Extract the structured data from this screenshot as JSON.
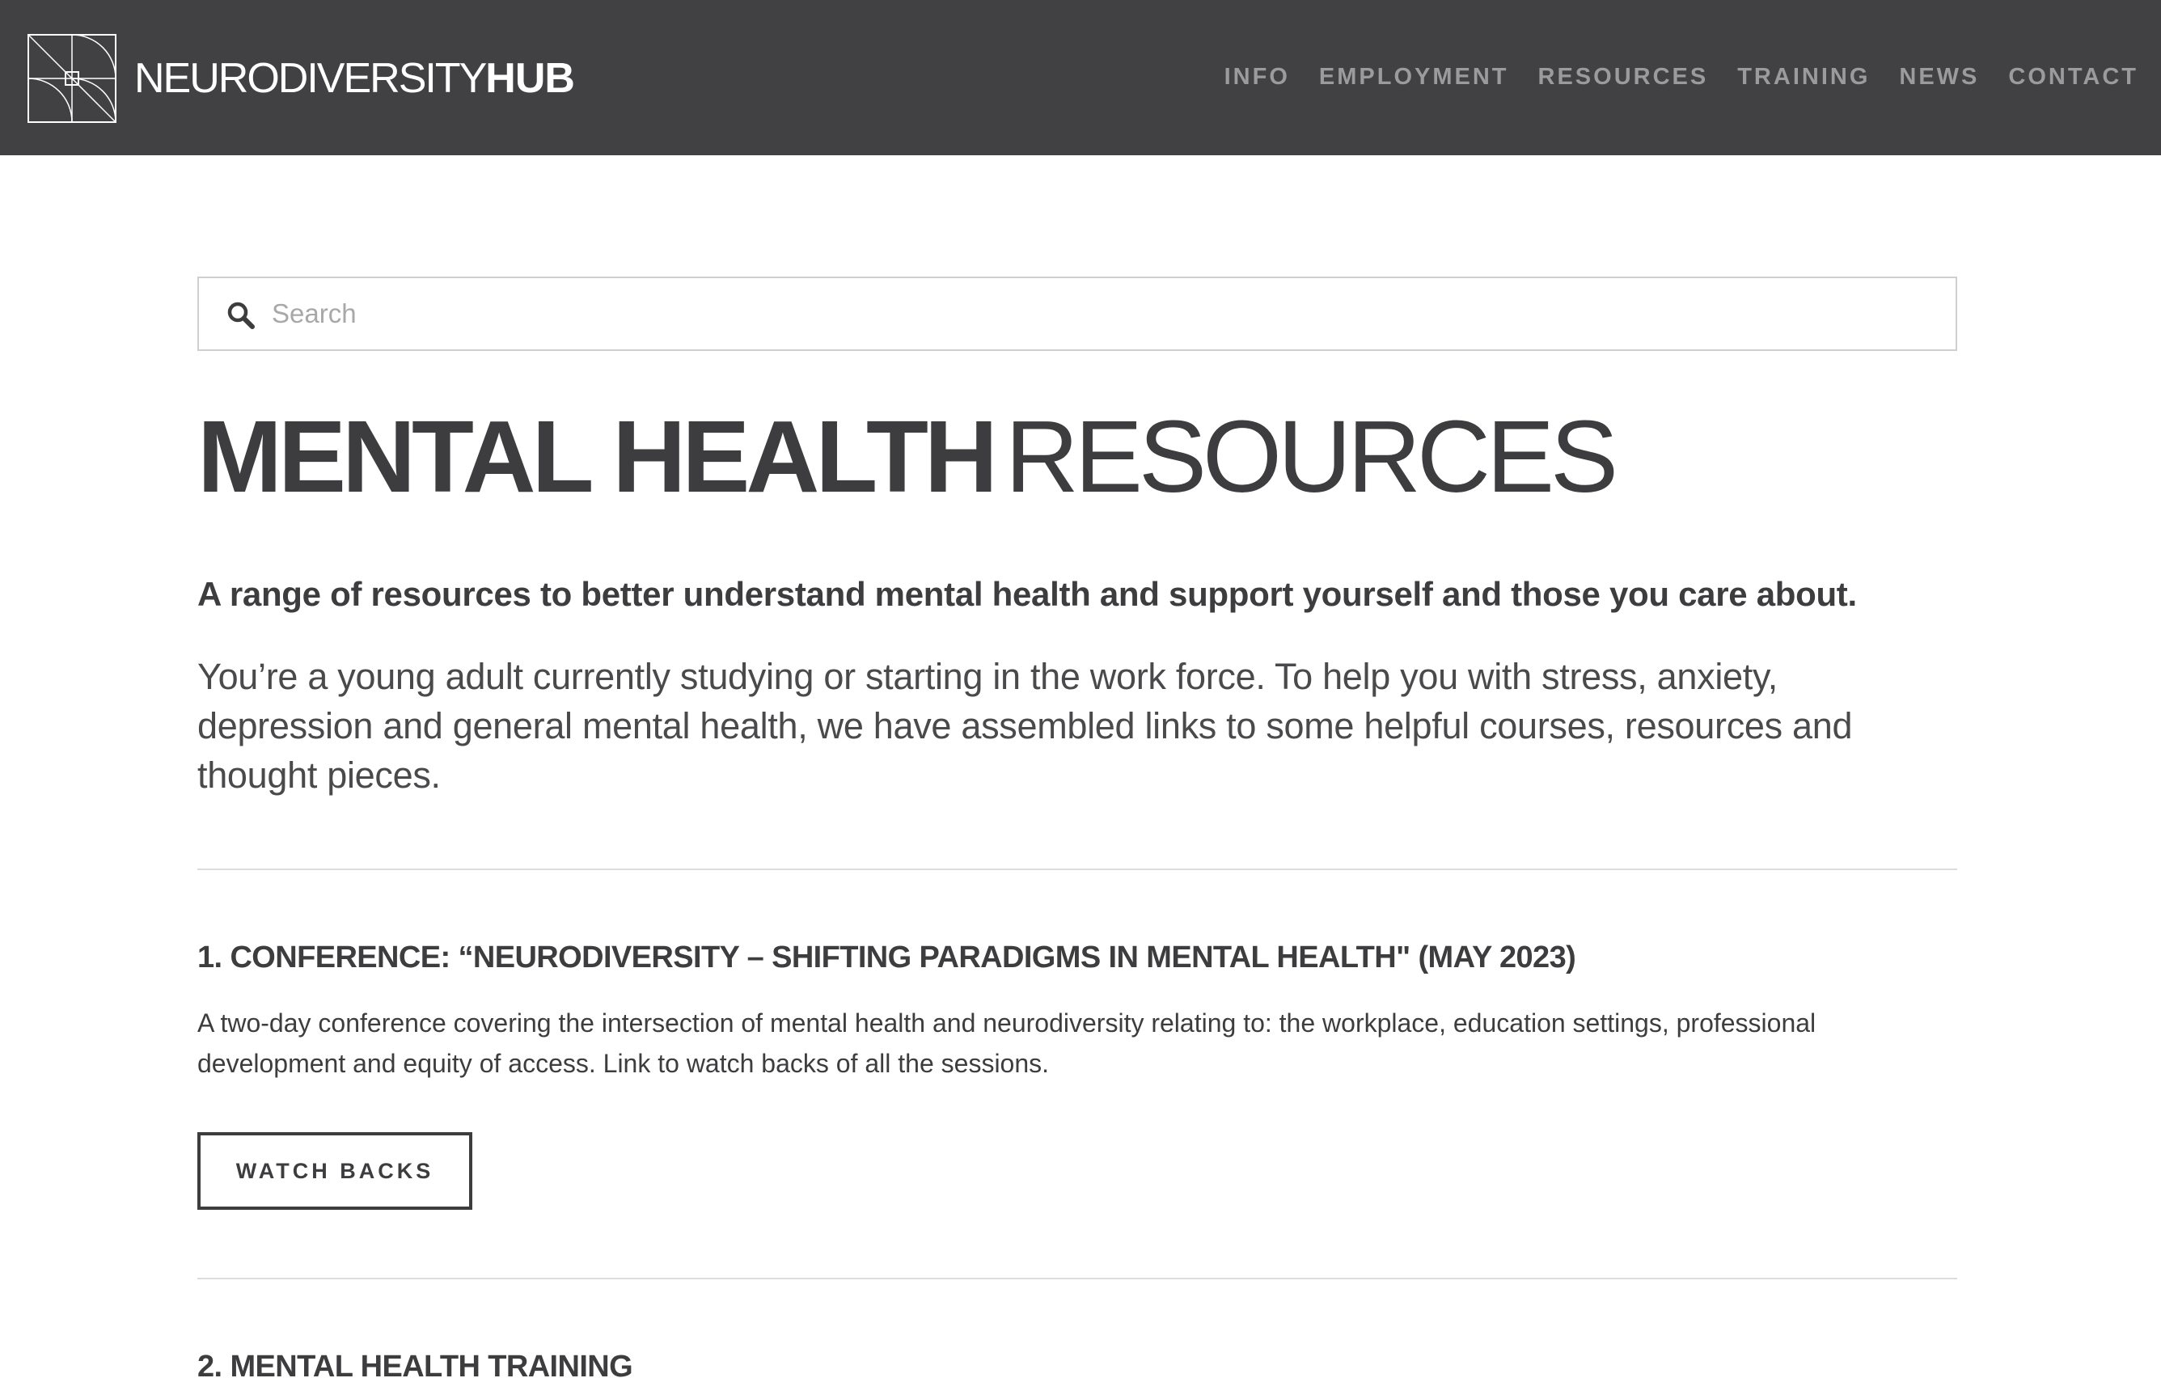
{
  "header": {
    "brand_light": "NEURODIVERSITY",
    "brand_bold": "HUB",
    "logo_icon": "geometric-square-logo",
    "nav": [
      {
        "label": "INFO"
      },
      {
        "label": "EMPLOYMENT"
      },
      {
        "label": "RESOURCES"
      },
      {
        "label": "TRAINING"
      },
      {
        "label": "NEWS"
      },
      {
        "label": "CONTACT"
      }
    ]
  },
  "search": {
    "placeholder": "Search",
    "value": "",
    "icon": "search-icon"
  },
  "page": {
    "title_bold": "MENTAL HEALTH",
    "title_light": "RESOURCES",
    "lead": "A range of resources to better understand mental health and support yourself and those you care about.",
    "intro": "You’re a young adult currently studying or starting in the work force. To help you with stress, anxiety, depression and general mental health, we have assembled links to some helpful courses, resources and thought pieces."
  },
  "sections": [
    {
      "title": "1. CONFERENCE: “NEURODIVERSITY – SHIFTING PARADIGMS IN MENTAL HEALTH\" (MAY 2023)",
      "description": "A two-day conference covering the intersection of mental health and neurodiversity relating to: the workplace, education settings, professional development and equity of access. Link to watch backs of all the sessions.",
      "button_label": "WATCH BACKS"
    },
    {
      "title": "2. MENTAL HEALTH TRAINING"
    }
  ],
  "colors": {
    "header_bg": "#414143",
    "nav_text": "#9b9b9d",
    "body_text": "#3d3d3f",
    "divider": "#dcdcde"
  }
}
